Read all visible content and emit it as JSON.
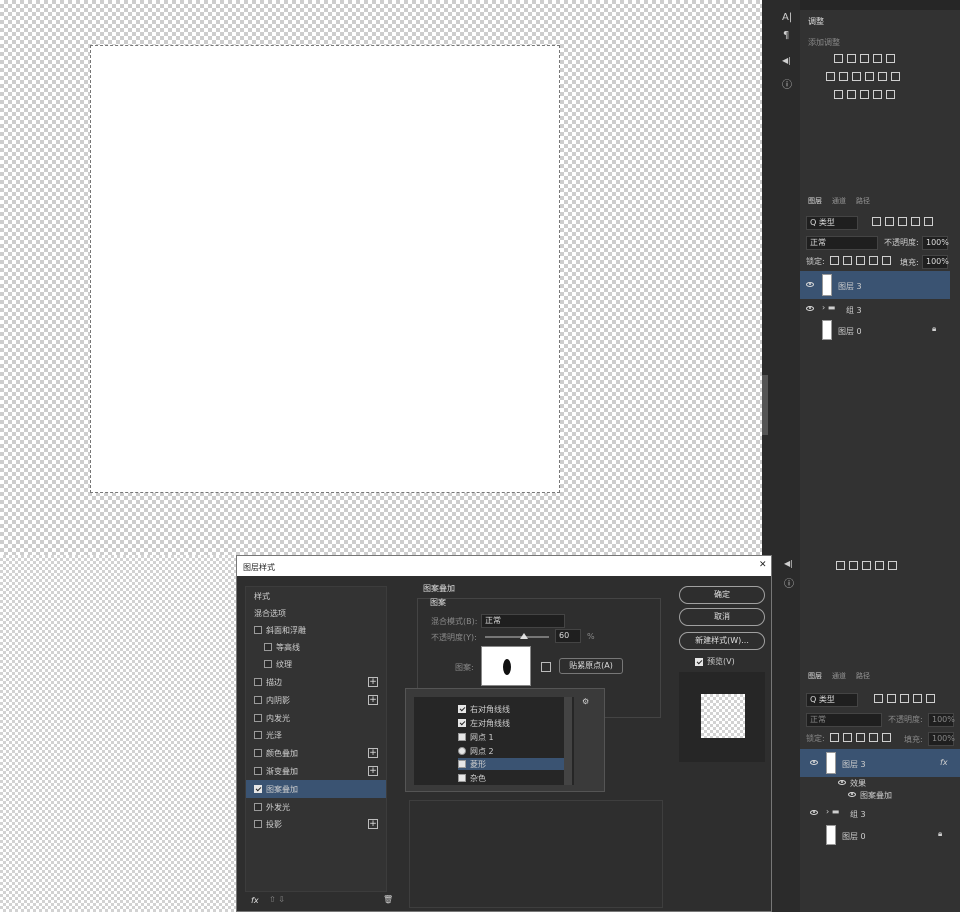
{
  "colors": {
    "panel": "#323232",
    "selection": "#3a5372",
    "canvas": "#ffffff"
  },
  "side_tools": {
    "tool1": "A|",
    "tool2": "¶",
    "tool3": "◀|",
    "tool4": "ⓘ"
  },
  "adjust_panel": {
    "title": "调整",
    "subtitle": "添加调整"
  },
  "layers_panel_top": {
    "tabs": [
      "图层",
      "通道",
      "路径"
    ],
    "filter": "Q 类型",
    "blend_mode": "正常",
    "opacity_label": "不透明度:",
    "opacity_value": "100%",
    "lock_label": "锁定:",
    "fill_label": "填充:",
    "fill_value": "100%",
    "layers": [
      {
        "name": "图层 3"
      },
      {
        "name": "组 3"
      },
      {
        "name": "图层 0"
      }
    ]
  },
  "dialog": {
    "title": "图层样式",
    "close": "✕",
    "left_items": [
      "样式",
      "混合选项",
      "斜面和浮雕",
      "等高线",
      "纹理",
      "描边",
      "内阴影",
      "内发光",
      "光泽",
      "颜色叠加",
      "渐变叠加",
      "图案叠加",
      "外发光",
      "投影"
    ],
    "section_title": "图案叠加",
    "group_title": "图案",
    "blend_label": "混合模式(B):",
    "blend_value": "正常",
    "opacity_label": "不透明度(Y):",
    "opacity_value": "60",
    "opacity_unit": "%",
    "pattern_label": "图案:",
    "snap_button": "贴紧原点(A)",
    "ok": "确定",
    "cancel": "取消",
    "new_style": "新建样式(W)...",
    "preview_label": "预览(V)",
    "fx": "fx",
    "pattern_list": [
      "右对角线线",
      "左对角线线",
      "网点 1",
      "网点 2",
      "菱形",
      "杂色"
    ]
  },
  "layers_panel_bottom": {
    "tabs": [
      "图层",
      "通道",
      "路径"
    ],
    "filter": "Q 类型",
    "blend_mode": "正常",
    "opacity_label": "不透明度:",
    "opacity_value": "100%",
    "lock_label": "锁定:",
    "fill_label": "填充:",
    "fill_value": "100%",
    "layer3": "图层 3",
    "effects": "效果",
    "pattern_overlay": "图案叠加",
    "group": "组 3",
    "layer0": "图层 0",
    "fx_badge": "fx"
  }
}
